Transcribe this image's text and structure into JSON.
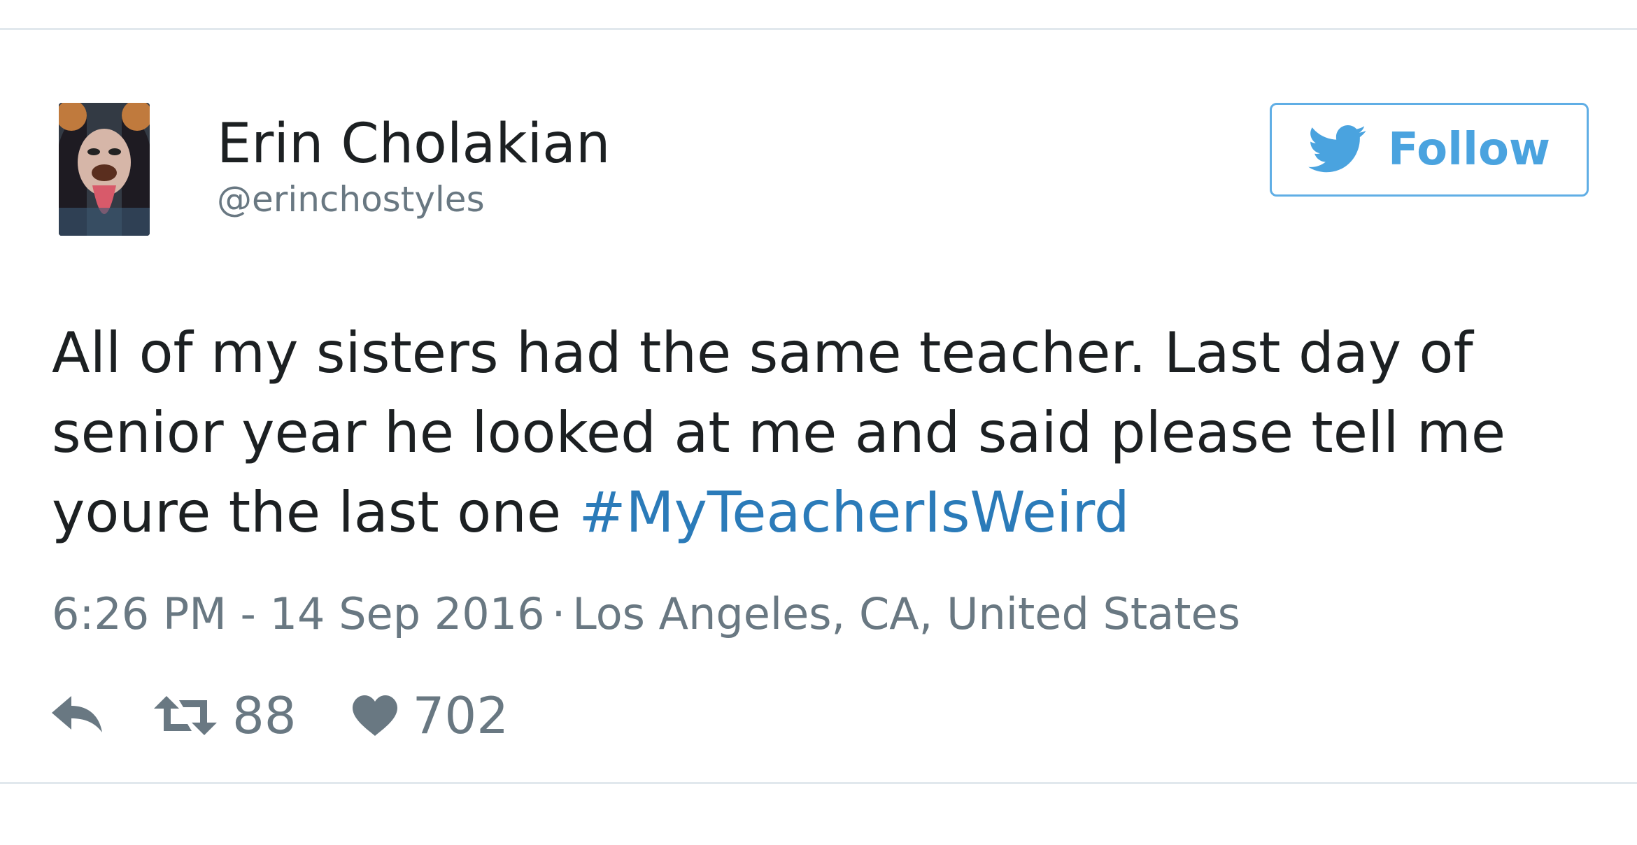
{
  "tweet": {
    "author": {
      "display_name": "Erin Cholakian",
      "handle": "@erinchostyles"
    },
    "follow_button": {
      "label": "Follow"
    },
    "text": {
      "line1": "All of my sisters had the same teacher. Last day of",
      "line2": "senior year he looked at me and said please tell me",
      "line3_prefix": "youre the last one ",
      "hashtag": "#MyTeacherIsWeird"
    },
    "meta": {
      "timestamp": "6:26 PM - 14 Sep 2016",
      "separator": "·",
      "location": "Los Angeles, CA, United States"
    },
    "actions": {
      "reply_icon": "reply-arrow",
      "retweet_icon": "retweet-arrows",
      "retweet_count": "88",
      "like_icon": "heart",
      "like_count": "702"
    }
  },
  "colors": {
    "text": "#1c2022",
    "muted": "#697882",
    "hashtag": "#2b7bb9",
    "twitter_blue": "#4aa3df",
    "divider": "#e1e8ed"
  }
}
